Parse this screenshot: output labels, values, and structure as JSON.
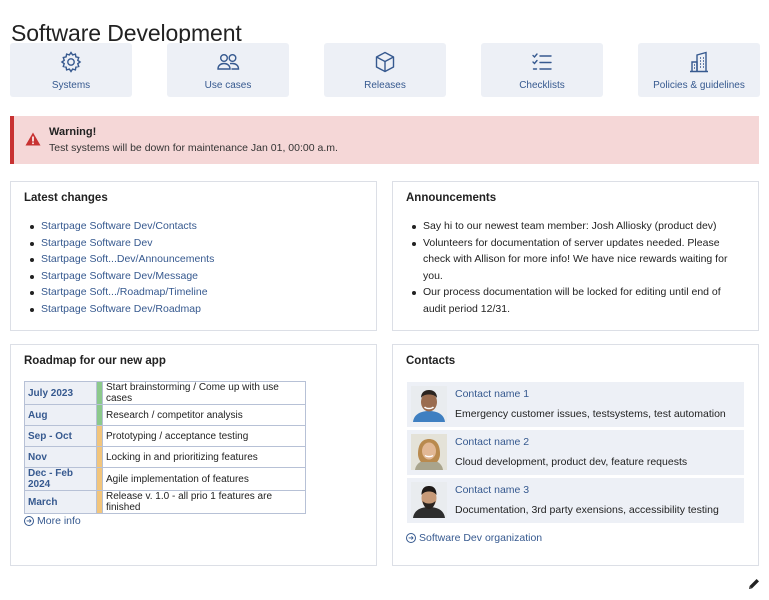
{
  "page": {
    "title": "Software Development"
  },
  "tiles": [
    {
      "label": "Systems",
      "icon": "gear-icon"
    },
    {
      "label": "Use cases",
      "icon": "users-icon"
    },
    {
      "label": "Releases",
      "icon": "box-icon"
    },
    {
      "label": "Checklists",
      "icon": "checklist-icon"
    },
    {
      "label": "Policies & guidelines",
      "icon": "building-icon"
    }
  ],
  "warning": {
    "title": "Warning!",
    "text": "Test systems will be down for maintenance Jan 01, 00:00 a.m.",
    "color": "#c83232",
    "background": "#f5d7d7"
  },
  "latest_changes": {
    "title": "Latest changes",
    "items": [
      "Startpage Software Dev/Contacts",
      "Startpage Software Dev",
      "Startpage Soft...Dev/Announcements",
      "Startpage Software Dev/Message",
      "Startpage Soft.../Roadmap/Timeline",
      "Startpage Software Dev/Roadmap"
    ]
  },
  "announcements": {
    "title": "Announcements",
    "items": [
      "Say hi to our newest team member: Josh Alliosky (product dev)",
      "Volunteers for documentation of server updates needed. Please check with Allison for more info! We have nice rewards waiting for you.",
      "Our process documentation will be locked for editing until end of audit period 12/31."
    ]
  },
  "roadmap": {
    "title": "Roadmap for our new app",
    "rows": [
      {
        "when": "July 2023",
        "what": "Start brainstorming / Come up with use cases",
        "color": "#8cc98c"
      },
      {
        "when": "Aug",
        "what": "Research / competitor analysis",
        "color": "#8cc98c"
      },
      {
        "when": "Sep - Oct",
        "what": "Prototyping / acceptance testing",
        "color": "#f2c57c"
      },
      {
        "when": "Nov",
        "what": "Locking in and prioritizing features",
        "color": "#f2c57c"
      },
      {
        "when": "Dec - Feb 2024",
        "what": "Agile implementation of features",
        "color": "#f2c57c"
      },
      {
        "when": "March",
        "what": "Release v. 1.0 - all prio 1 features are finished",
        "color": "#f2c57c"
      }
    ],
    "more_label": "More info"
  },
  "contacts": {
    "title": "Contacts",
    "items": [
      {
        "name": "Contact name 1",
        "desc": "Emergency customer issues, testsystems, test automation"
      },
      {
        "name": "Contact name 2",
        "desc": "Cloud development, product dev, feature requests"
      },
      {
        "name": "Contact name 3",
        "desc": "Documentation, 3rd party exensions, accessibility testing"
      }
    ],
    "org_link": "Software Dev organization"
  },
  "colors": {
    "accent": "#36598f",
    "tile_bg": "#edf0f6",
    "panel_border": "#dcdfe6"
  }
}
